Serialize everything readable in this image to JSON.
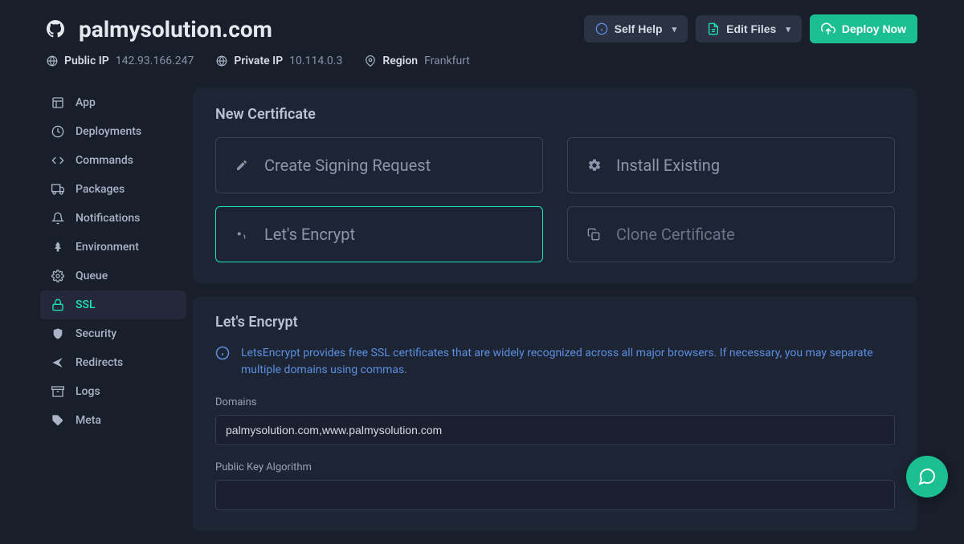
{
  "header": {
    "site_title": "palmysolution.com",
    "self_help": "Self Help",
    "edit_files": "Edit Files",
    "deploy_now": "Deploy Now"
  },
  "meta": {
    "public_ip_label": "Public IP",
    "public_ip_value": "142.93.166.247",
    "private_ip_label": "Private IP",
    "private_ip_value": "10.114.0.3",
    "region_label": "Region",
    "region_value": "Frankfurt"
  },
  "sidebar": {
    "items": [
      {
        "label": "App"
      },
      {
        "label": "Deployments"
      },
      {
        "label": "Commands"
      },
      {
        "label": "Packages"
      },
      {
        "label": "Notifications"
      },
      {
        "label": "Environment"
      },
      {
        "label": "Queue"
      },
      {
        "label": "SSL"
      },
      {
        "label": "Security"
      },
      {
        "label": "Redirects"
      },
      {
        "label": "Logs"
      },
      {
        "label": "Meta"
      }
    ]
  },
  "cert_panel": {
    "title": "New Certificate",
    "options": [
      {
        "label": "Create Signing Request"
      },
      {
        "label": "Install Existing"
      },
      {
        "label": "Let's Encrypt"
      },
      {
        "label": "Clone Certificate"
      }
    ]
  },
  "le_panel": {
    "title": "Let's Encrypt",
    "info": "LetsEncrypt provides free SSL certificates that are widely recognized across all major browsers. If necessary, you may separate multiple domains using commas.",
    "domains_label": "Domains",
    "domains_value": "palmysolution.com,www.palmysolution.com",
    "algo_label": "Public Key Algorithm"
  }
}
